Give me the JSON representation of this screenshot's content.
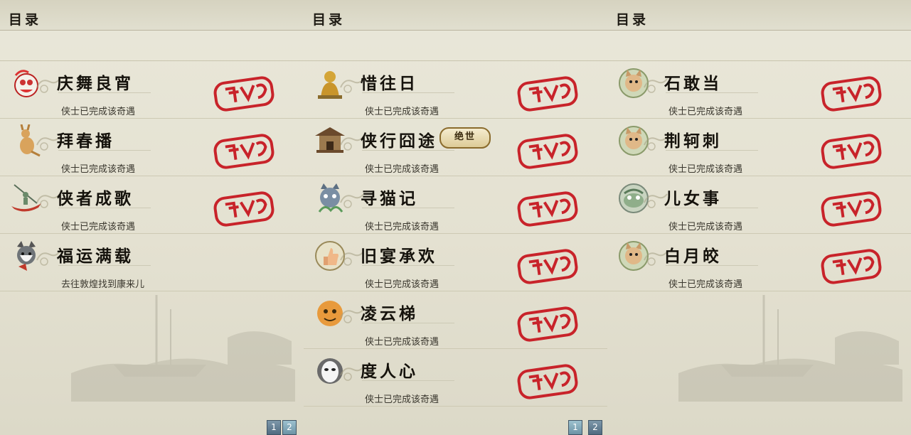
{
  "panels": [
    {
      "header": "目录",
      "quests": [
        {
          "title": "庆舞良宵",
          "status": "侠士已完成该奇遇",
          "completed": true,
          "icon": "lion-dance-icon"
        },
        {
          "title": "拜春播",
          "status": "侠士已完成该奇遇",
          "completed": true,
          "icon": "kangaroo-icon"
        },
        {
          "title": "侠者成歌",
          "status": "侠士已完成该奇遇",
          "completed": true,
          "icon": "fisherman-boat-icon"
        },
        {
          "title": "福运满载",
          "status": "去往敦煌找到康来儿",
          "completed": false,
          "icon": "husky-dog-icon"
        }
      ],
      "pager": {
        "pages": [
          "1",
          "2"
        ],
        "active": "2"
      }
    },
    {
      "header": "目录",
      "quests": [
        {
          "title": "惜往日",
          "status": "侠士已完成该奇遇",
          "completed": true,
          "icon": "golden-buddha-icon"
        },
        {
          "title": "侠行囧途",
          "status": "侠士已完成该奇遇",
          "completed": true,
          "icon": "pavilion-icon",
          "badge": "绝世"
        },
        {
          "title": "寻猫记",
          "status": "侠士已完成该奇遇",
          "completed": true,
          "icon": "blue-cat-icon"
        },
        {
          "title": "旧宴承欢",
          "status": "侠士已完成该奇遇",
          "completed": true,
          "icon": "thumbs-up-icon"
        },
        {
          "title": "凌云梯",
          "status": "侠士已完成该奇遇",
          "completed": true,
          "icon": "orange-face-icon"
        },
        {
          "title": "度人心",
          "status": "侠士已完成该奇遇",
          "completed": true,
          "icon": "white-mask-icon"
        }
      ],
      "pager": {
        "pages": [
          "1",
          "2"
        ],
        "active": "1"
      }
    },
    {
      "header": "目录",
      "quests": [
        {
          "title": "石敢当",
          "status": "侠士已完成该奇遇",
          "completed": true,
          "icon": "cat-face-icon"
        },
        {
          "title": "荆轲刺",
          "status": "侠士已完成该奇遇",
          "completed": true,
          "icon": "cat-face-icon"
        },
        {
          "title": "儿女事",
          "status": "侠士已完成该奇遇",
          "completed": true,
          "icon": "green-creature-icon"
        },
        {
          "title": "白月皎",
          "status": "侠士已完成该奇遇",
          "completed": true,
          "icon": "cat-face-icon"
        }
      ]
    }
  ],
  "colors": {
    "stamp": "#c8232a",
    "pager": "#5a7488",
    "text": "#1e1b14"
  }
}
